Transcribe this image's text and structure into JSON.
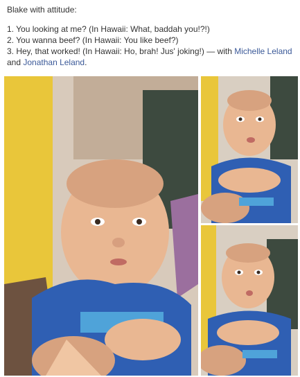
{
  "post": {
    "title": "Blake with attitude:",
    "lines": [
      "1. You looking at me? (In Hawaii: What, baddah you!?!)",
      "2. You wanna beef? (In Hawaii: You like beef?)",
      "3. Hey, that worked! (In Hawaii: Ho, brah! Jus' joking!)"
    ],
    "with_text": " — with ",
    "tagged": [
      "Michelle Leland",
      "Jonathan Leland"
    ],
    "and_text": " and ",
    "period": "."
  },
  "photos": [
    {
      "id": "main",
      "subject": "baby-blue-onesie-photo"
    },
    {
      "id": "top-right",
      "subject": "baby-blue-onesie-photo"
    },
    {
      "id": "bottom-right",
      "subject": "baby-blue-onesie-photo"
    }
  ],
  "colors": {
    "link": "#3b5998",
    "text": "#333333",
    "onesie": "#2f5fb3",
    "skin": "#e8b48f",
    "background_wall": "#d9cfc2",
    "yellow_cloth": "#e9c63a"
  }
}
